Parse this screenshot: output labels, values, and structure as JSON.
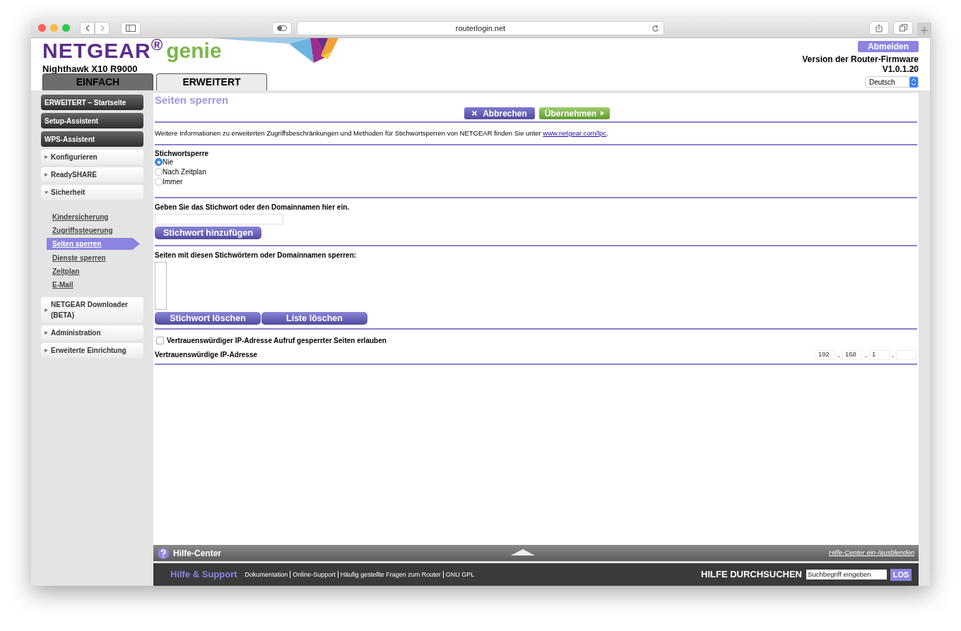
{
  "browser": {
    "url": "routerlogin.net"
  },
  "header": {
    "brand": "NETGEAR$^{®}$",
    "product": "genie",
    "model": "Nighthawk X10 R9000",
    "logout": "Abmelden",
    "firmware_label": "Version der Router-Firmware",
    "firmware_version": "V1.0.1.20",
    "language": "Deutsch"
  },
  "tabs": [
    {
      "label": "EINFACH",
      "selected": false
    },
    {
      "label": "ERWEITERT",
      "selected": true
    }
  ],
  "sidebar": {
    "items": [
      {
        "kind": "dark",
        "label": "ERWEITERT – Startseite"
      },
      {
        "kind": "dark",
        "label": "Setup-Assistent"
      },
      {
        "kind": "dark",
        "label": "WPS-Assistent"
      },
      {
        "kind": "group",
        "label": "Konfigurieren",
        "expanded": false
      },
      {
        "kind": "group",
        "label": "ReadySHARE",
        "expanded": false
      },
      {
        "kind": "group",
        "label": "Sicherheit",
        "expanded": true,
        "children": [
          {
            "label": "Kindersicherung",
            "selected": false
          },
          {
            "label": "Zugriffssteuerung",
            "selected": false
          },
          {
            "label": "Seiten sperren",
            "selected": true
          },
          {
            "label": "Dienste sperren",
            "selected": false
          },
          {
            "label": "Zeitplan",
            "selected": false
          },
          {
            "label": "E-Mail",
            "selected": false
          }
        ]
      },
      {
        "kind": "group",
        "label": "NETGEAR Downloader (BETA)",
        "expanded": false
      },
      {
        "kind": "group",
        "label": "Administration",
        "expanded": false
      },
      {
        "kind": "group",
        "label": "Erweiterte Einrichtung",
        "expanded": false
      }
    ]
  },
  "main": {
    "title": "Seiten sperren",
    "cancel": "Abbrechen",
    "apply": "Übernehmen",
    "info": {
      "text": "Weitere Informationen zu erweiterten Zugriffsbeschränkungen und Methoden für Stichwortsperren von NETGEAR finden Sie unter ",
      "link": "www.netgear.com/lpc",
      "after": "."
    },
    "keyword_block": {
      "label": "Stichwortsperre",
      "options": [
        {
          "label": "Nie",
          "selected": true
        },
        {
          "label": "Nach Zeitplan",
          "selected": false
        },
        {
          "label": "Immer",
          "selected": false
        }
      ]
    },
    "keyword_entry": {
      "label": "Geben Sie das Stichwort oder den Domainnamen hier ein.",
      "button": "Stichwort hinzufügen"
    },
    "blocked_list": {
      "label": "Seiten mit diesen Stichwörtern oder Domainnamen sperren:",
      "buttons": [
        "Stichwort löschen",
        "Liste löschen"
      ]
    },
    "trusted": {
      "checkbox": {
        "label": "Vertrauenswürdiger IP-Adresse Aufruf gesperrter Seiten erlauben",
        "checked": false
      },
      "ip_label": "Vertrauenswürdige IP-Adresse",
      "separator": ".",
      "octets": [
        "192",
        "168",
        "1"
      ]
    }
  },
  "help_bar": {
    "title": "Hilfe-Center",
    "toggle": "Hilfe-Center ein-/ausblenden"
  },
  "footer": {
    "title": "Hilfe & Support",
    "links": [
      "Dokumentation",
      "Online-Support",
      "Häufig gestellte Fragen zum Router",
      "GNU GPL"
    ],
    "search_label": "HILFE DURCHSUCHEN",
    "search_placeholder": "Suchbegriff eingeben",
    "search_button": "LOS"
  }
}
